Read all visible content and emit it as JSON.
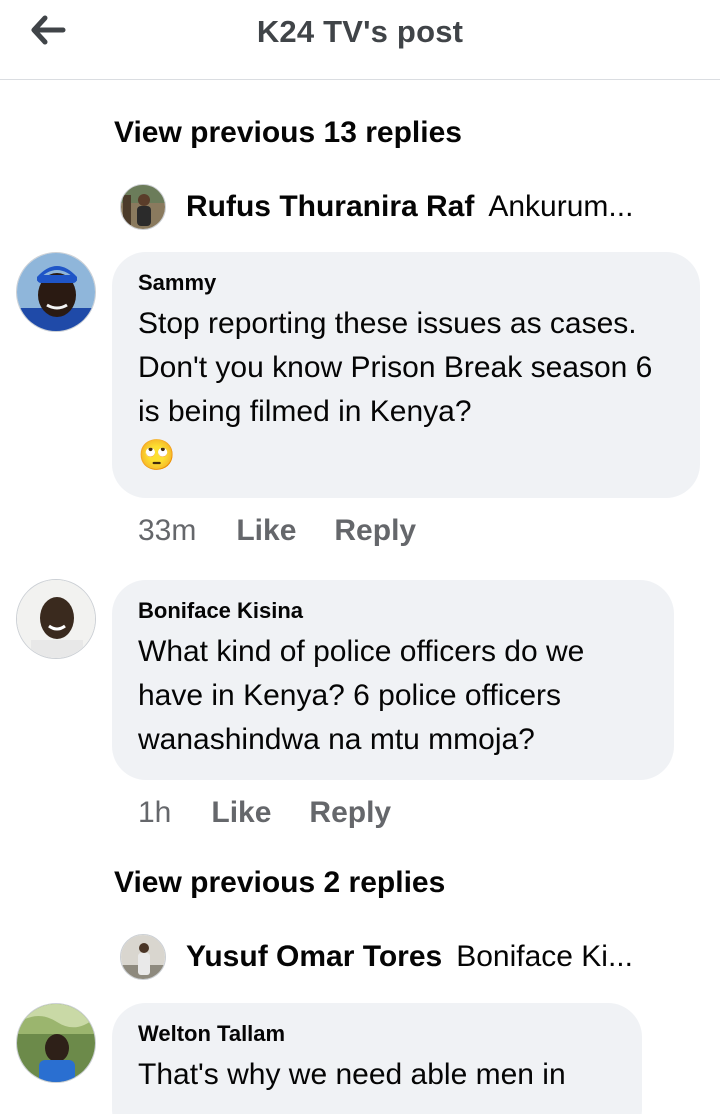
{
  "header": {
    "title": "K24 TV's post",
    "back_icon": "arrow-left-icon"
  },
  "thread1": {
    "view_previous_label": "View previous 13 replies",
    "reply_preview": {
      "name": "Rufus Thuranira Raf",
      "text": "Ankurum..."
    }
  },
  "comments": [
    {
      "author": "Sammy",
      "text": "Stop reporting these issues as cases. Don't you know Prison Break season 6 is being filmed in Kenya?",
      "emoji": "🙄",
      "time": "33m",
      "like_label": "Like",
      "reply_label": "Reply"
    },
    {
      "author": "Boniface Kisina",
      "text": "What kind of police officers do we have in Kenya? 6 police officers wanashindwa na mtu mmoja?",
      "time": "1h",
      "like_label": "Like",
      "reply_label": "Reply"
    },
    {
      "author": "Welton Tallam",
      "text": "That's why we need able men in"
    }
  ],
  "thread2": {
    "view_previous_label": "View previous 2 replies",
    "reply_preview": {
      "name": "Yusuf Omar Tores",
      "text": "Boniface Ki..."
    }
  },
  "colors": {
    "bubble_bg": "#f0f2f5",
    "meta_text": "#65676b",
    "header_title": "#404448"
  }
}
